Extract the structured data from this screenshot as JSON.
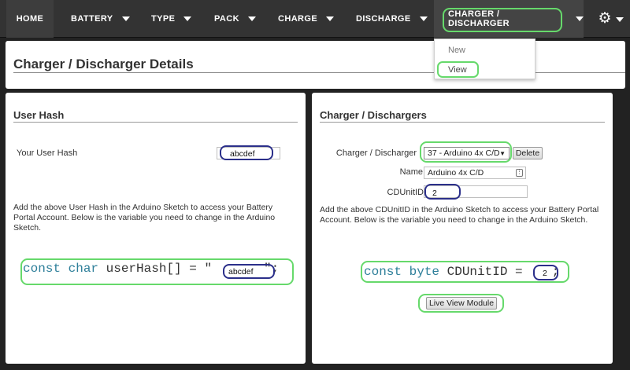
{
  "nav": {
    "items": [
      "HOME",
      "BATTERY",
      "TYPE",
      "PACK",
      "CHARGE",
      "DISCHARGE",
      "CHARGER / DISCHARGER"
    ],
    "settings_icon": "gear-icon"
  },
  "dropdown": {
    "items": [
      "New",
      "View"
    ]
  },
  "page": {
    "title": "Charger / Discharger Details"
  },
  "user_hash_card": {
    "title": "User Hash",
    "field_label": "Your User Hash",
    "field_value": "abcdef",
    "instructions": "Add the above User Hash in the Arduino Sketch to access your Battery Portal Account. Below is the variable you need to change in the Arduino Sketch.",
    "code_keyword": "const char",
    "code_rest": "userHash[] = \"",
    "code_value": "abcdef",
    "code_end": "\";"
  },
  "chargers_card": {
    "title": "Charger / Dischargers",
    "select_label": "Charger / Discharger",
    "select_value": "37 - Arduino 4x C/D",
    "delete_label": "Delete",
    "name_label": "Name",
    "name_value": "Arduino 4x C/D",
    "cdunitid_label": "CDUnitID",
    "cdunitid_value": "2",
    "instructions": "Add the above CDUnitID in the Arduino Sketch to access your Battery Portal Account. Below is the variable you need to change in the Arduino Sketch.",
    "code_keyword": "const byte",
    "code_rest": "CDUnitID =",
    "code_value": "2",
    "code_end": ";",
    "live_view_label": "Live View Module"
  },
  "colors": {
    "highlight_green": "#66d96b",
    "highlight_navy": "#2b2f8a",
    "navbar": "#333333"
  }
}
